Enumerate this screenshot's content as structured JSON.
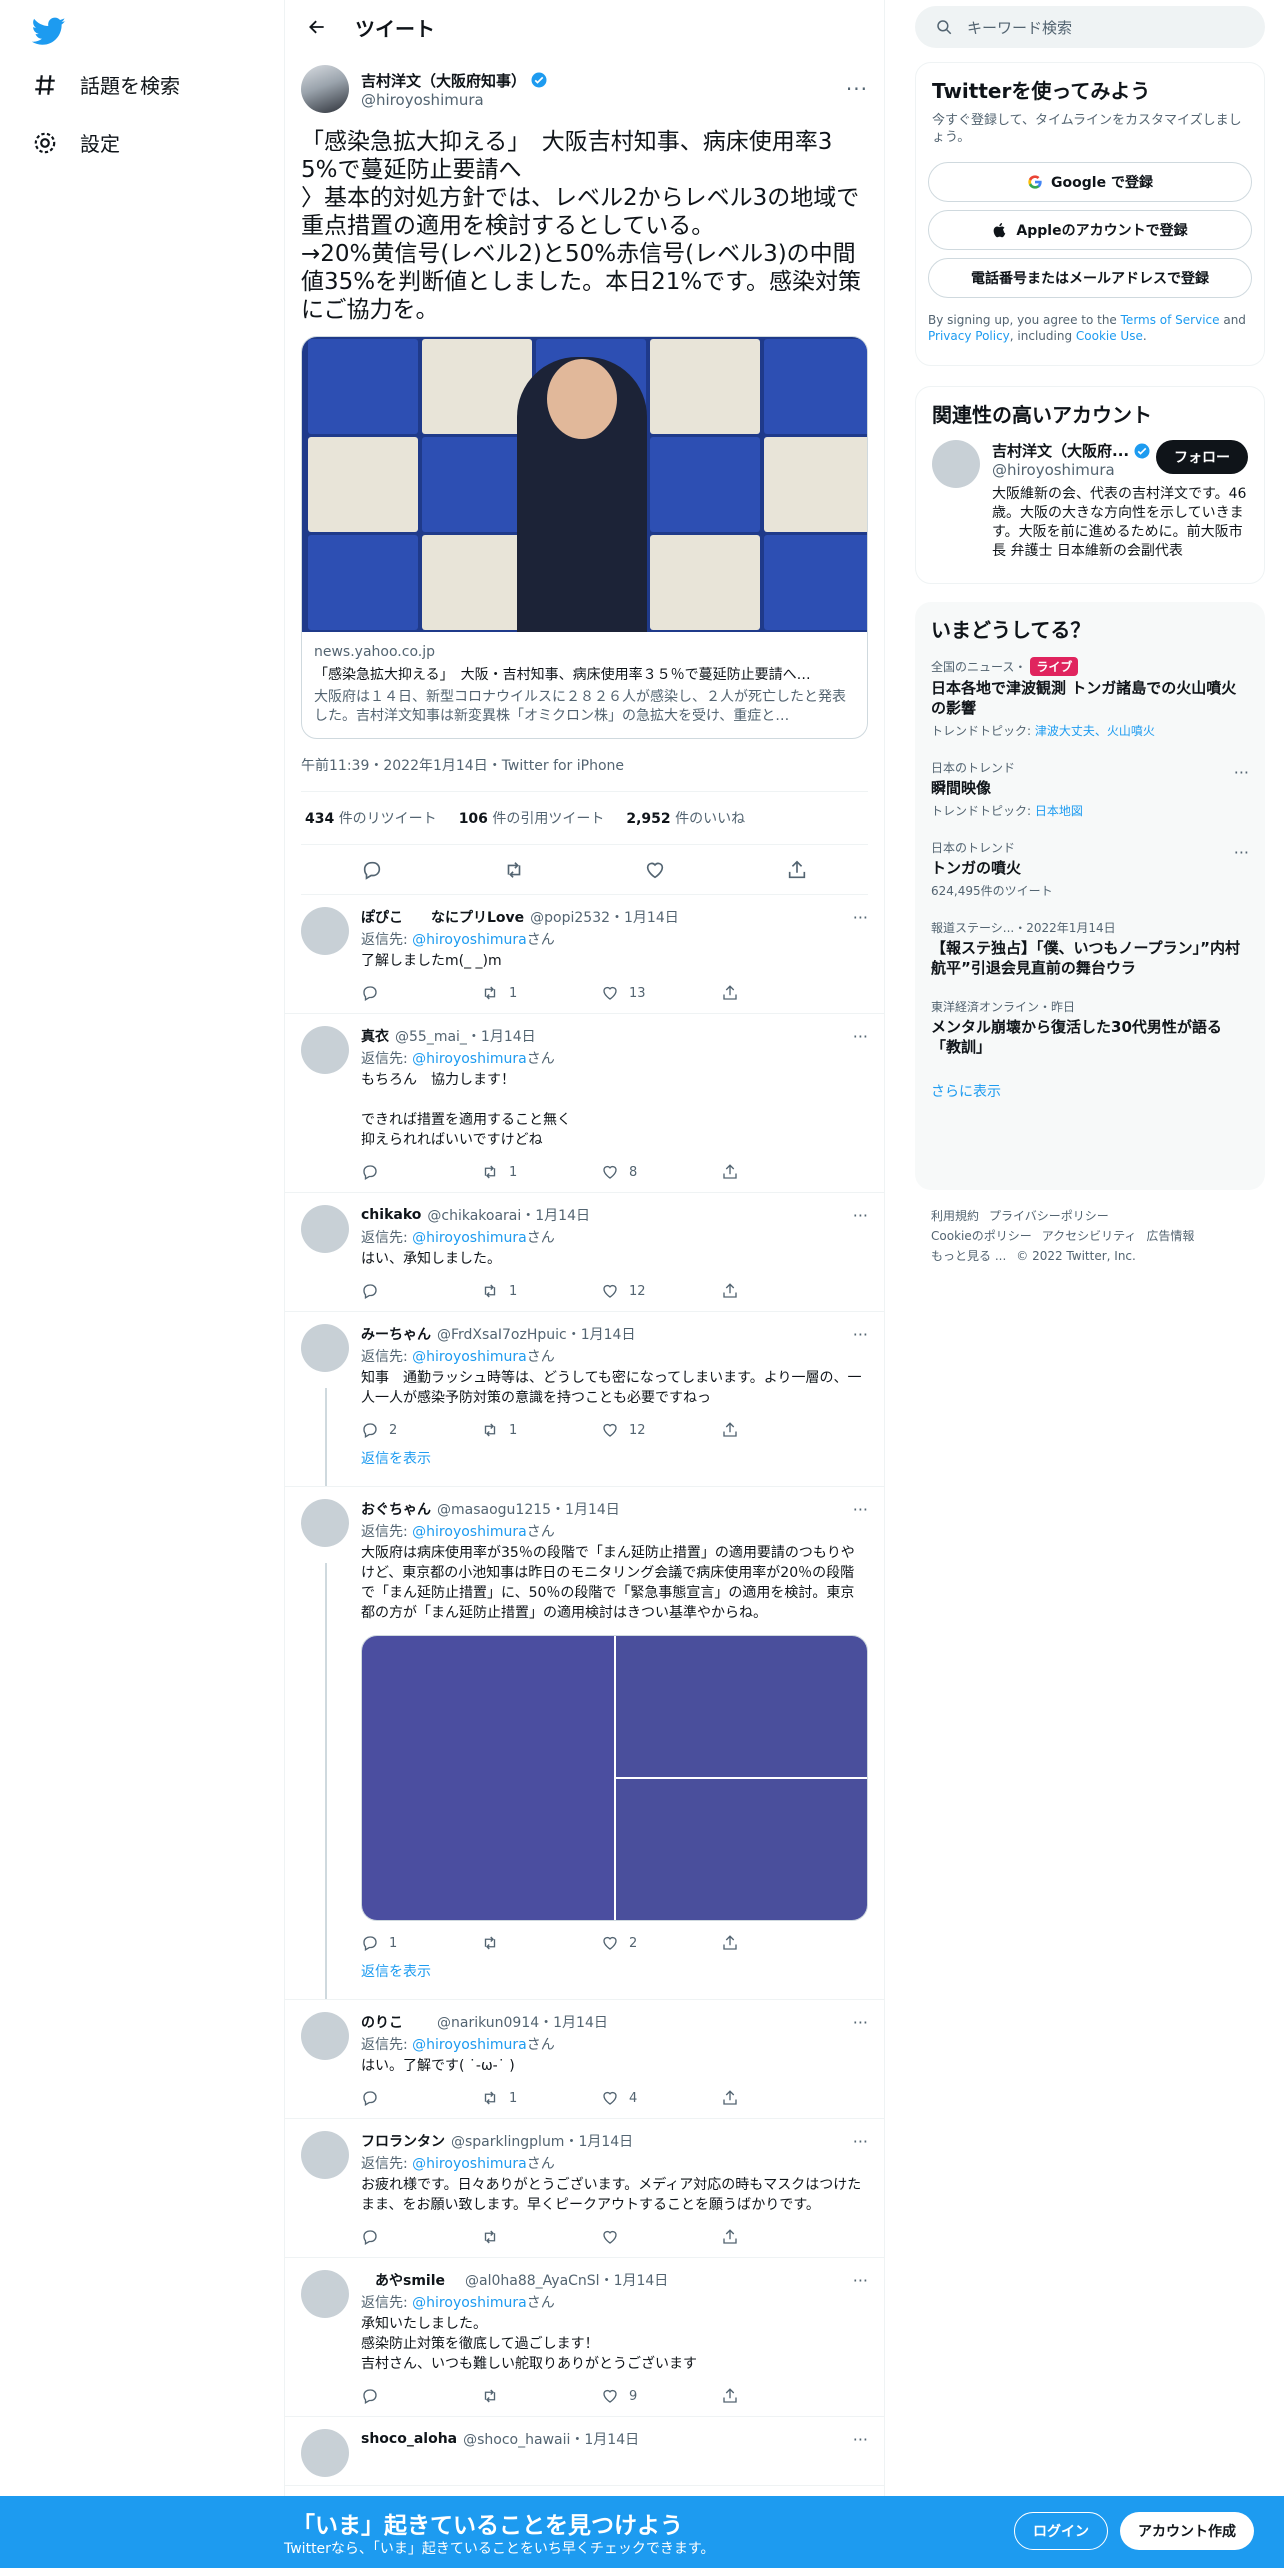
{
  "nav": {
    "logo": "twitter-logo-icon",
    "items": [
      {
        "label": "話題を検索",
        "icon": "hashtag-icon"
      },
      {
        "label": "設定",
        "icon": "gear-icon"
      }
    ]
  },
  "header": {
    "title": "ツイート"
  },
  "main_tweet": {
    "name": "吉村洋文（大阪府知事）",
    "handle": "@hiroyoshimura",
    "text": "「感染急拡大抑える」　大阪吉村知事、病床使用率35%で蔓延防止要請へ\n〉基本的対処方針では、レベル2からレベル3の地域で重点措置の適用を検討するとしている。\n→20%黄信号(レベル2)と50%赤信号(レベル3)の中間値35%を判断値としました。本日21%です。感染対策にご協力を。",
    "card": {
      "domain": "news.yahoo.co.jp",
      "title": "「感染急拡大抑える」　大阪・吉村知事、病床使用率３５％で蔓延防止要請へ…",
      "description": "大阪府は１４日、新型コロナウイルスに２８２６人が感染し、２人が死亡したと発表した。吉村洋文知事は新変異株「オミクロン株」の急拡大を受け、重症と…"
    },
    "meta": "午前11:39・2022年1月14日・Twitter for iPhone",
    "stats": [
      {
        "count": "434",
        "label": "件のリツイート"
      },
      {
        "count": "106",
        "label": "件の引用ツイート"
      },
      {
        "count": "2,952",
        "label": "件のいいね"
      }
    ]
  },
  "replies": [
    {
      "name": "ぽぴこ　　なにプリLove",
      "meta": "@popi2532・1月14日",
      "to": "@hiroyoshimura",
      "text": "了解しましたm(_ _)m",
      "replies": "",
      "retweets": "1",
      "likes": "13"
    },
    {
      "name": "真衣",
      "meta": "@55_mai_・1月14日",
      "to": "@hiroyoshimura",
      "text": "もちろん　協力します！\n\nできれば措置を適用すること無く\n抑えられればいいですけどね",
      "replies": "",
      "retweets": "1",
      "likes": "8"
    },
    {
      "name": "chikako",
      "meta": "@chikakoarai・1月14日",
      "to": "@hiroyoshimura",
      "text": "はい、承知しました。",
      "replies": "",
      "retweets": "1",
      "likes": "12"
    },
    {
      "name": "みーちゃん",
      "meta": "@FrdXsaI7ozHpuic・1月14日",
      "to": "@hiroyoshimura",
      "text": "知事　通勤ラッシュ時等は、どうしても密になってしまいます。より一層の、一人一人が感染予防対策の意識を持つことも必要ですねっ",
      "replies": "2",
      "retweets": "1",
      "likes": "12",
      "show_replies": "返信を表示"
    },
    {
      "name": "おぐちゃん",
      "meta": "@masaogu1215・1月14日",
      "to": "@hiroyoshimura",
      "text": "大阪府は病床使用率が35％の段階で「まん延防止措置」の適用要請のつもりやけど、東京都の小池知事は昨日のモニタリング会議で病床使用率が20％の段階で「まん延防止措置」に、50％の段階で「緊急事態宣言」の適用を検討。東京都の方が「まん延防止措置」の適用検討はきつい基準やからね。",
      "replies": "1",
      "retweets": "",
      "likes": "2",
      "show_replies": "返信を表示",
      "media": true
    },
    {
      "name": "のりこ",
      "meta": "　　@narikun0914・1月14日",
      "to": "@hiroyoshimura",
      "text": "はい。了解です( ˙-ω-˙ )",
      "replies": "",
      "retweets": "1",
      "likes": "4"
    },
    {
      "name": "フロランタン",
      "meta": "@sparklingplum・1月14日",
      "to": "@hiroyoshimura",
      "text": "お疲れ様です。日々ありがとうございます。メディア対応の時もマスクはつけたまま、をお願い致します。早くピークアウトすることを願うばかりです。",
      "replies": "",
      "retweets": "",
      "likes": ""
    },
    {
      "name": "　あやsmile",
      "meta": "　@al0ha88_AyaCnSl・1月14日",
      "to": "@hiroyoshimura",
      "text": "承知いたしました。\n感染防止対策を徹底して過ごします！\n吉村さん、いつも難しい舵取りありがとうございます",
      "replies": "",
      "retweets": "",
      "likes": "9"
    },
    {
      "name": "shoco_aloha",
      "meta": "@shoco_hawaii・1月14日",
      "to": "",
      "text": "",
      "replies": "",
      "retweets": "",
      "likes": ""
    }
  ],
  "reply_to_label": "返信先: ",
  "reply_to_suffix": "さん",
  "right": {
    "search_placeholder": "キーワード検索",
    "signup": {
      "title": "Twitterを使ってみよう",
      "subtitle": "今すぐ登録して、タイムラインをカスタマイズしましょう。",
      "google": "Google で登録",
      "apple": "Appleのアカウントで登録",
      "phone": "電話番号またはメールアドレスで登録",
      "terms_1": "By signing up, you agree to the ",
      "terms_link": "Terms of Service",
      "terms_2": " and ",
      "privacy_link": "Privacy Policy",
      "terms_3": ", including ",
      "cookie_link": "Cookie Use",
      "terms_4": "."
    },
    "related": {
      "title": "関連性の高いアカウント",
      "name": "吉村洋文（大阪府...",
      "handle": "@hiroyoshimura",
      "follow": "フォロー",
      "bio": "大阪維新の会、代表の吉村洋文です。46歳。大阪の大きな方向性を示していきます。大阪を前に進めるために。前大阪市長 弁護士 日本維新の会副代表"
    },
    "trends": {
      "title": "いまどうしてる？",
      "items": [
        {
          "category": "全国のニュース・",
          "live": "ライブ",
          "title": "日本各地で津波観測 トンガ諸島での火山噴火の影響",
          "sub_label": "トレンドトピック: ",
          "sub_links": "津波大丈夫、火山噴火"
        },
        {
          "category": "日本のトレンド",
          "title": "瞬間映像",
          "sub_label": "トレンドトピック: ",
          "sub_links": "日本地図"
        },
        {
          "category": "日本のトレンド",
          "title": "トンガの噴火",
          "sub": "624,495件のツイート"
        },
        {
          "category": "報道ステーシ...・2022年1月14日",
          "title": "【報ステ独占】「僕、いつもノープラン」”内村航平”引退会見直前の舞台ウラ"
        },
        {
          "category": "東洋経済オンライン・昨日",
          "title": "メンタル崩壊から復活した30代男性が語る「教訓」"
        }
      ],
      "show_more": "さらに表示"
    },
    "footer": {
      "line1": [
        "利用規約",
        "プライバシーポリシー"
      ],
      "line2": [
        "Cookieのポリシー",
        "アクセシビリティ",
        "広告情報"
      ],
      "line3": [
        "もっと見る ...",
        "© 2022 Twitter, Inc."
      ]
    }
  },
  "banner": {
    "title": "「いま」起きていることを見つけよう",
    "subtitle": "Twitterなら、「いま」起きていることをいち早くチェックできます。",
    "login": "ログイン",
    "signup": "アカウント作成"
  },
  "colors": {
    "accent": "#1d9bf0",
    "text": "#0f1419",
    "muted": "#536471"
  }
}
